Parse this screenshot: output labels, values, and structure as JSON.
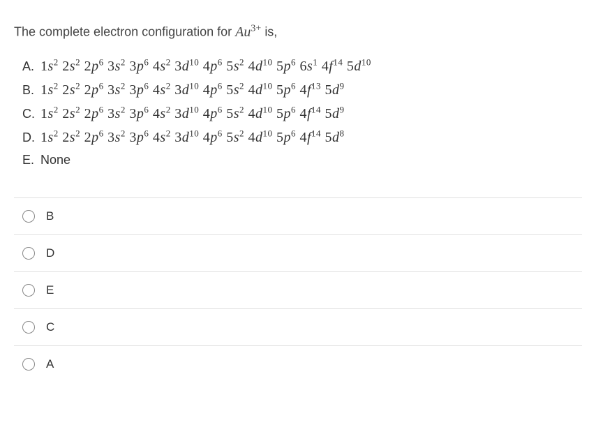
{
  "question": {
    "prefix": "The complete electron configuration for ",
    "species_base": "Au",
    "species_charge": "3+",
    "suffix": " is,"
  },
  "choices": [
    {
      "letter": "A.",
      "config_html": "1<span class='orb'>s</span><sup>2</sup> 2<span class='orb'>s</span><sup>2</sup> 2<span class='orb'>p</span><sup>6</sup> 3<span class='orb'>s</span><sup>2</sup> 3<span class='orb'>p</span><sup>6</sup> 4<span class='orb'>s</span><sup>2</sup> 3<span class='orb'>d</span><sup>10</sup> 4<span class='orb'>p</span><sup>6</sup> 5<span class='orb'>s</span><sup>2</sup> 4<span class='orb'>d</span><sup>10</sup> 5<span class='orb'>p</span><sup>6</sup> 6<span class='orb'>s</span><sup>1</sup> 4<span class='orb'>f</span><sup>14</sup> 5<span class='orb'>d</span><sup>10</sup>"
    },
    {
      "letter": "B.",
      "config_html": "1<span class='orb'>s</span><sup>2</sup> 2<span class='orb'>s</span><sup>2</sup> 2<span class='orb'>p</span><sup>6</sup> 3<span class='orb'>s</span><sup>2</sup> 3<span class='orb'>p</span><sup>6</sup> 4<span class='orb'>s</span><sup>2</sup> 3<span class='orb'>d</span><sup>10</sup> 4<span class='orb'>p</span><sup>6</sup> 5<span class='orb'>s</span><sup>2</sup> 4<span class='orb'>d</span><sup>10</sup> 5<span class='orb'>p</span><sup>6</sup> 4<span class='orb'>f</span><sup>13</sup> 5<span class='orb'>d</span><sup>9</sup>"
    },
    {
      "letter": "C.",
      "config_html": "1<span class='orb'>s</span><sup>2</sup> 2<span class='orb'>s</span><sup>2</sup> 2<span class='orb'>p</span><sup>6</sup> 3<span class='orb'>s</span><sup>2</sup> 3<span class='orb'>p</span><sup>6</sup> 4<span class='orb'>s</span><sup>2</sup> 3<span class='orb'>d</span><sup>10</sup> 4<span class='orb'>p</span><sup>6</sup> 5<span class='orb'>s</span><sup>2</sup> 4<span class='orb'>d</span><sup>10</sup> 5<span class='orb'>p</span><sup>6</sup> 4<span class='orb'>f</span><sup>14</sup> 5<span class='orb'>d</span><sup>9</sup>"
    },
    {
      "letter": "D.",
      "config_html": "1<span class='orb'>s</span><sup>2</sup> 2<span class='orb'>s</span><sup>2</sup> 2<span class='orb'>p</span><sup>6</sup> 3<span class='orb'>s</span><sup>2</sup> 3<span class='orb'>p</span><sup>6</sup> 4<span class='orb'>s</span><sup>2</sup> 3<span class='orb'>d</span><sup>10</sup> 4<span class='orb'>p</span><sup>6</sup> 5<span class='orb'>s</span><sup>2</sup> 4<span class='orb'>d</span><sup>10</sup> 5<span class='orb'>p</span><sup>6</sup> 4<span class='orb'>f</span><sup>14</sup> 5<span class='orb'>d</span><sup>8</sup>"
    },
    {
      "letter": "E.",
      "plain": "None"
    }
  ],
  "options": [
    {
      "label": "B"
    },
    {
      "label": "D"
    },
    {
      "label": "E"
    },
    {
      "label": "C"
    },
    {
      "label": "A"
    }
  ]
}
